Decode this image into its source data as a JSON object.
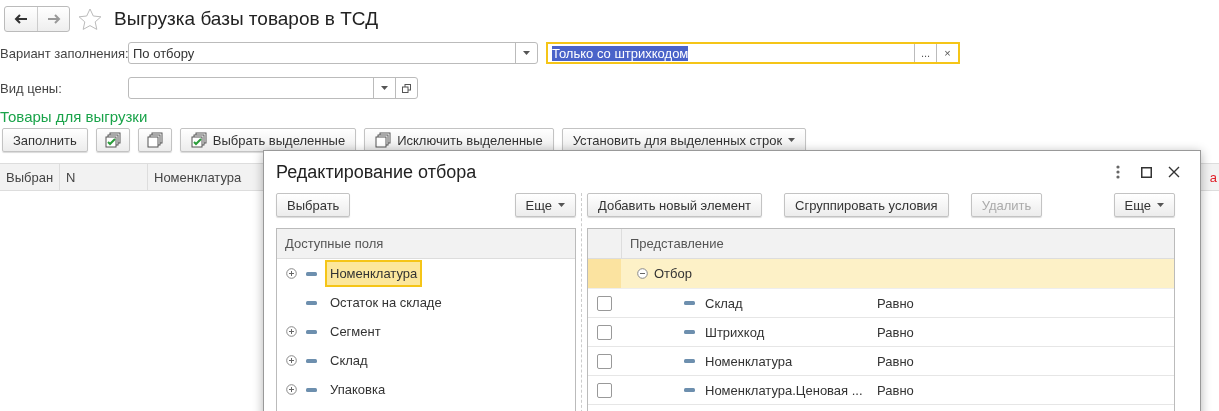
{
  "title": "Выгрузка базы товаров в ТСД",
  "fill_variant": {
    "label": "Вариант заполнения:",
    "value": "По отбору"
  },
  "filter_field": {
    "value": "Только со штрихкодом",
    "focused": true,
    "buttons": [
      "...",
      "×"
    ]
  },
  "price_type": {
    "label": "Вид цены:"
  },
  "section_title": "Товары для выгрузки",
  "toolbar": [
    {
      "kind": "text",
      "label": "Заполнить"
    },
    {
      "kind": "check"
    },
    {
      "kind": "uncheck"
    },
    {
      "kind": "check",
      "label": "Выбрать выделенные"
    },
    {
      "kind": "uncheck",
      "label": "Исключить выделенные"
    },
    {
      "kind": "menu",
      "label": "Установить для выделенных строк"
    }
  ],
  "table": {
    "columns": [
      {
        "label": "Выбран"
      },
      {
        "label": "N"
      },
      {
        "label": "Номенклатура"
      },
      {
        "label": "а",
        "color": "#e0202a"
      }
    ]
  },
  "dialog": {
    "title": "Редактирование отбора",
    "left": {
      "buttons": [
        {
          "kind": "text",
          "label": "Выбрать"
        },
        {
          "kind": "menu",
          "label": "Еще"
        }
      ],
      "tree": {
        "header": "Доступные поля",
        "items": [
          {
            "label": "Номенклатура",
            "expandable": true,
            "selected": true
          },
          {
            "label": "Остаток на складе",
            "expandable": false,
            "selected": false
          },
          {
            "label": "Сегмент",
            "expandable": true,
            "selected": false
          },
          {
            "label": "Склад",
            "expandable": true,
            "selected": false
          },
          {
            "label": "Упаковка",
            "expandable": true,
            "selected": false
          }
        ]
      }
    },
    "right": {
      "buttons": [
        {
          "kind": "text",
          "label": "Добавить новый элемент",
          "disabled": false
        },
        {
          "kind": "text",
          "label": "Сгруппировать условия",
          "disabled": false
        },
        {
          "kind": "text",
          "label": "Удалить",
          "disabled": true
        },
        {
          "kind": "menu",
          "label": "Еще",
          "disabled": false
        }
      ],
      "table": {
        "header": "Представление",
        "group": {
          "label": "Отбор",
          "expanded": true,
          "selected": true,
          "children": [
            {
              "name": "Склад",
              "condition": "Равно",
              "checked": false
            },
            {
              "name": "Штрихкод",
              "condition": "Равно",
              "checked": false
            },
            {
              "name": "Номенклатура",
              "condition": "Равно",
              "checked": false
            },
            {
              "name": "Номенклатура.Ценовая ...",
              "condition": "Равно",
              "checked": false
            }
          ]
        }
      }
    }
  }
}
